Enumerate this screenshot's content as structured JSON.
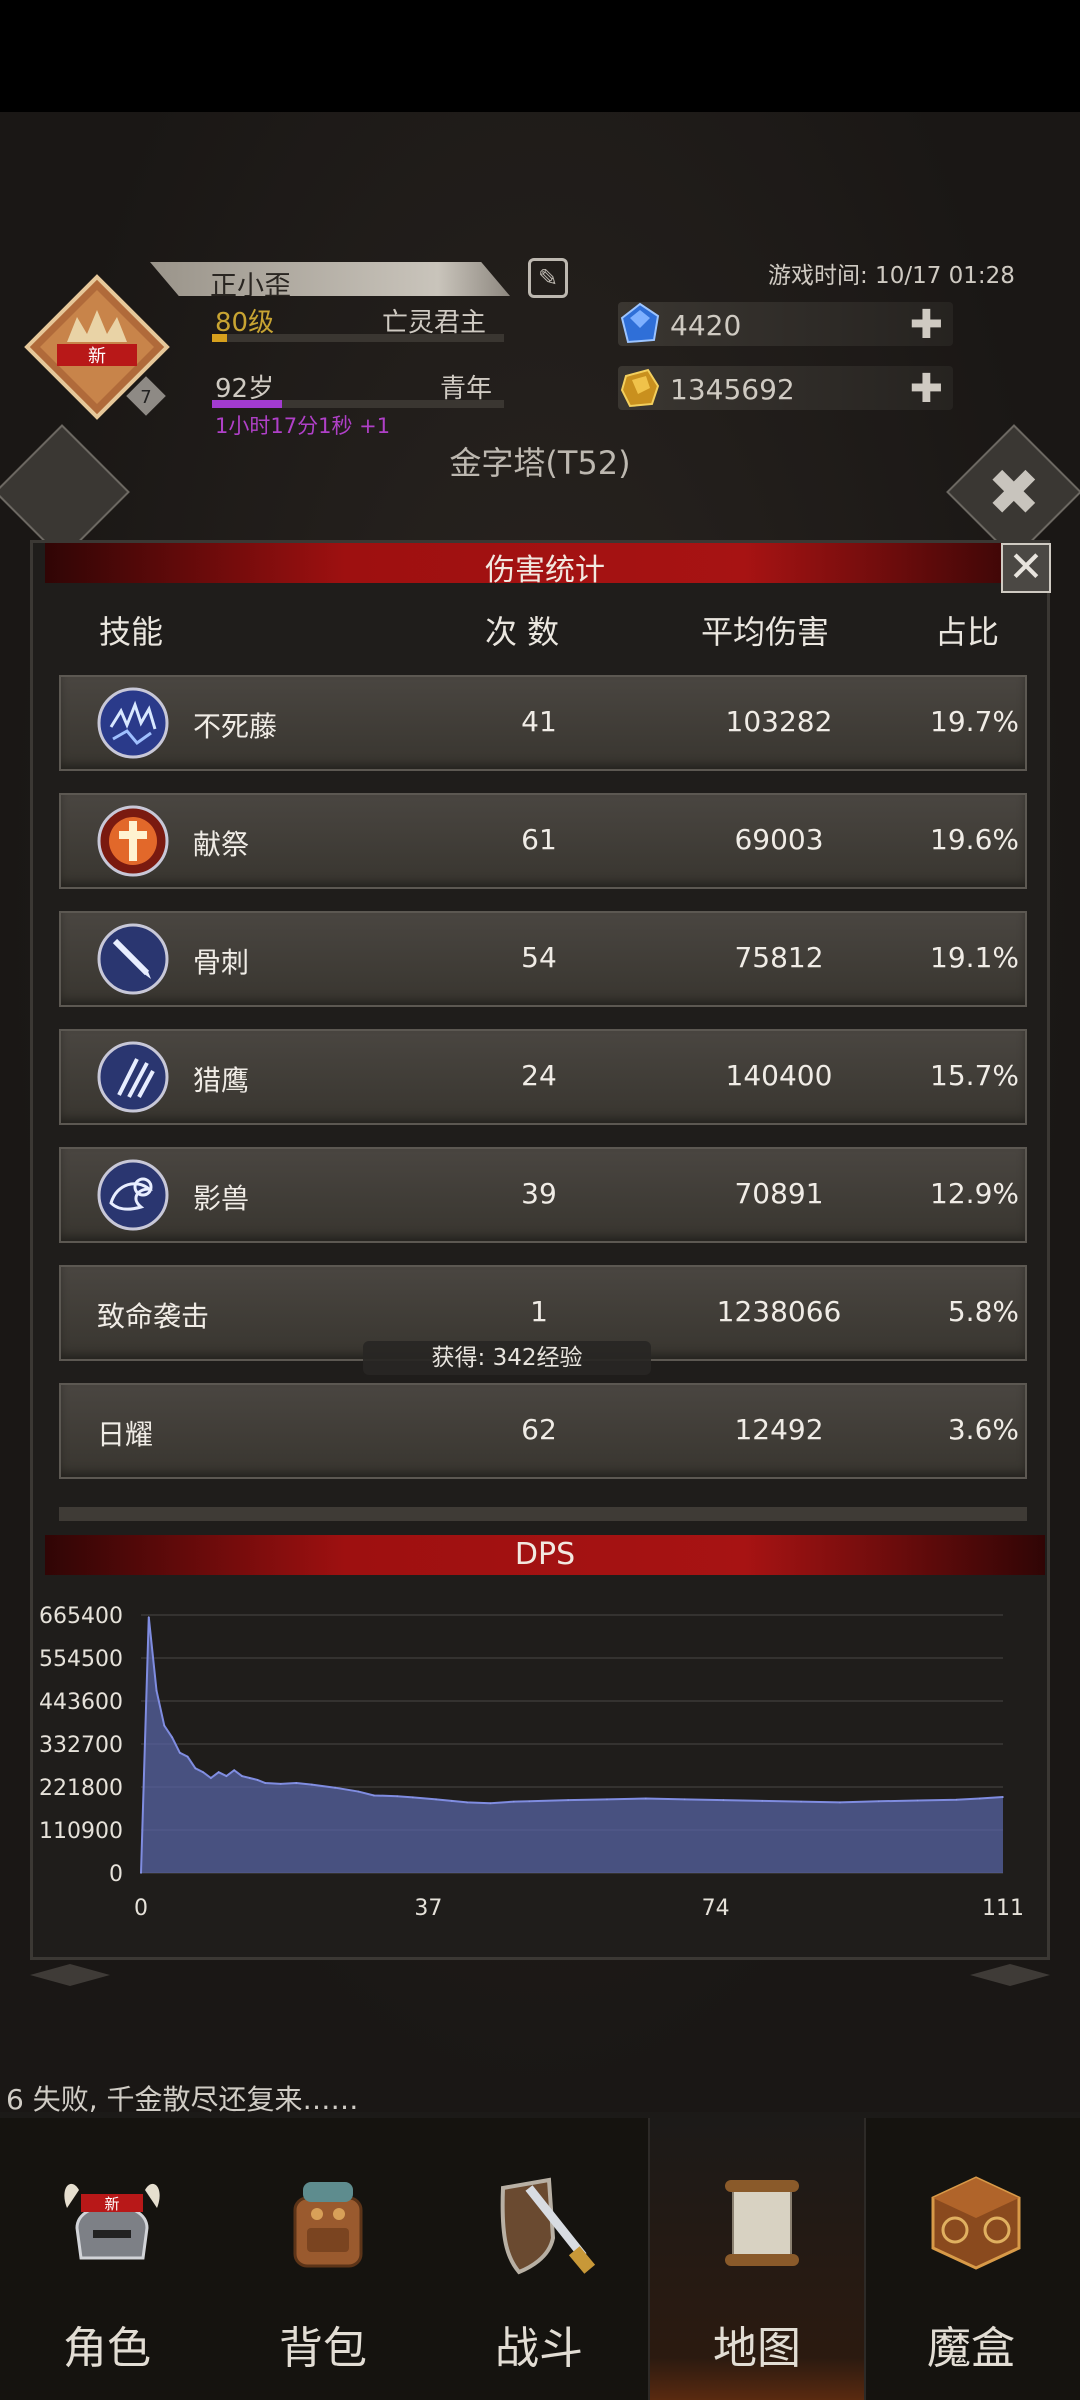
{
  "header": {
    "player_name": "正小歪",
    "level": "80级",
    "class": "亡灵君主",
    "level_progress": 0.05,
    "age": "92岁",
    "stage": "青年",
    "age_progress": 0.24,
    "timer": "1小时17分1秒 +1",
    "game_time": "游戏时间: 10/17 01:28",
    "badge_new": "新",
    "badge_num": "7",
    "gems": "4420",
    "gold": "1345692",
    "location": "金字塔(T52)"
  },
  "modal": {
    "title": "伤害统计",
    "close_icon": "close-x-icon",
    "columns": {
      "skill": "技能",
      "count": "次 数",
      "avg": "平均伤害",
      "ratio": "占比"
    },
    "rows": [
      {
        "name": "不死藤",
        "icon": "lightning-vine-icon",
        "count": "41",
        "avg": "103282",
        "ratio": "19.7%"
      },
      {
        "name": "献祭",
        "icon": "sacrifice-cross-icon",
        "count": "61",
        "avg": "69003",
        "ratio": "19.6%"
      },
      {
        "name": "骨刺",
        "icon": "bone-spear-icon",
        "count": "54",
        "avg": "75812",
        "ratio": "19.1%"
      },
      {
        "name": "猎鹰",
        "icon": "falcon-claw-icon",
        "count": "24",
        "avg": "140400",
        "ratio": "15.7%"
      },
      {
        "name": "影兽",
        "icon": "shadow-beast-icon",
        "count": "39",
        "avg": "70891",
        "ratio": "12.9%"
      },
      {
        "name": "致命袭击",
        "icon": "",
        "count": "1",
        "avg": "1238066",
        "ratio": "5.8%"
      },
      {
        "name": "日耀",
        "icon": "",
        "count": "62",
        "avg": "12492",
        "ratio": "3.6%"
      }
    ],
    "toast": "获得: 342经验",
    "dps_title": "DPS"
  },
  "chart_data": {
    "type": "area",
    "title": "DPS",
    "xlabel": "",
    "ylabel": "",
    "xlim": [
      0,
      111
    ],
    "ylim": [
      0,
      665400
    ],
    "x_ticks": [
      "0",
      "37",
      "74",
      "111"
    ],
    "y_ticks": [
      "665400",
      "554500",
      "443600",
      "332700",
      "221800",
      "110900",
      "0"
    ],
    "grid": true,
    "series": [
      {
        "color": "#5965a8",
        "x": [
          0,
          1,
          2,
          3,
          4,
          5,
          6,
          7,
          8,
          9,
          10,
          11,
          12,
          13,
          14,
          15,
          16,
          18,
          20,
          22,
          25,
          28,
          30,
          33,
          35,
          38,
          40,
          42,
          45,
          48,
          50,
          55,
          60,
          65,
          70,
          75,
          80,
          85,
          90,
          95,
          100,
          105,
          108,
          111
        ],
        "y": [
          0,
          660000,
          470000,
          380000,
          350000,
          310000,
          300000,
          270000,
          260000,
          245000,
          260000,
          250000,
          265000,
          250000,
          245000,
          240000,
          232000,
          230000,
          232000,
          228000,
          220000,
          210000,
          200000,
          198000,
          195000,
          190000,
          186000,
          182000,
          180000,
          184000,
          185000,
          188000,
          190000,
          192000,
          190000,
          188000,
          186000,
          184000,
          182000,
          185000,
          187000,
          189000,
          192000,
          196000
        ]
      }
    ]
  },
  "footer": {
    "message": "6 失败, 千金散尽还复来……"
  },
  "nav": [
    {
      "label": "角色",
      "icon": "helmet-icon",
      "badge": "新"
    },
    {
      "label": "背包",
      "icon": "backpack-icon"
    },
    {
      "label": "战斗",
      "icon": "sword-shield-icon"
    },
    {
      "label": "地图",
      "icon": "map-scroll-icon"
    },
    {
      "label": "魔盒",
      "icon": "magic-box-icon"
    }
  ]
}
